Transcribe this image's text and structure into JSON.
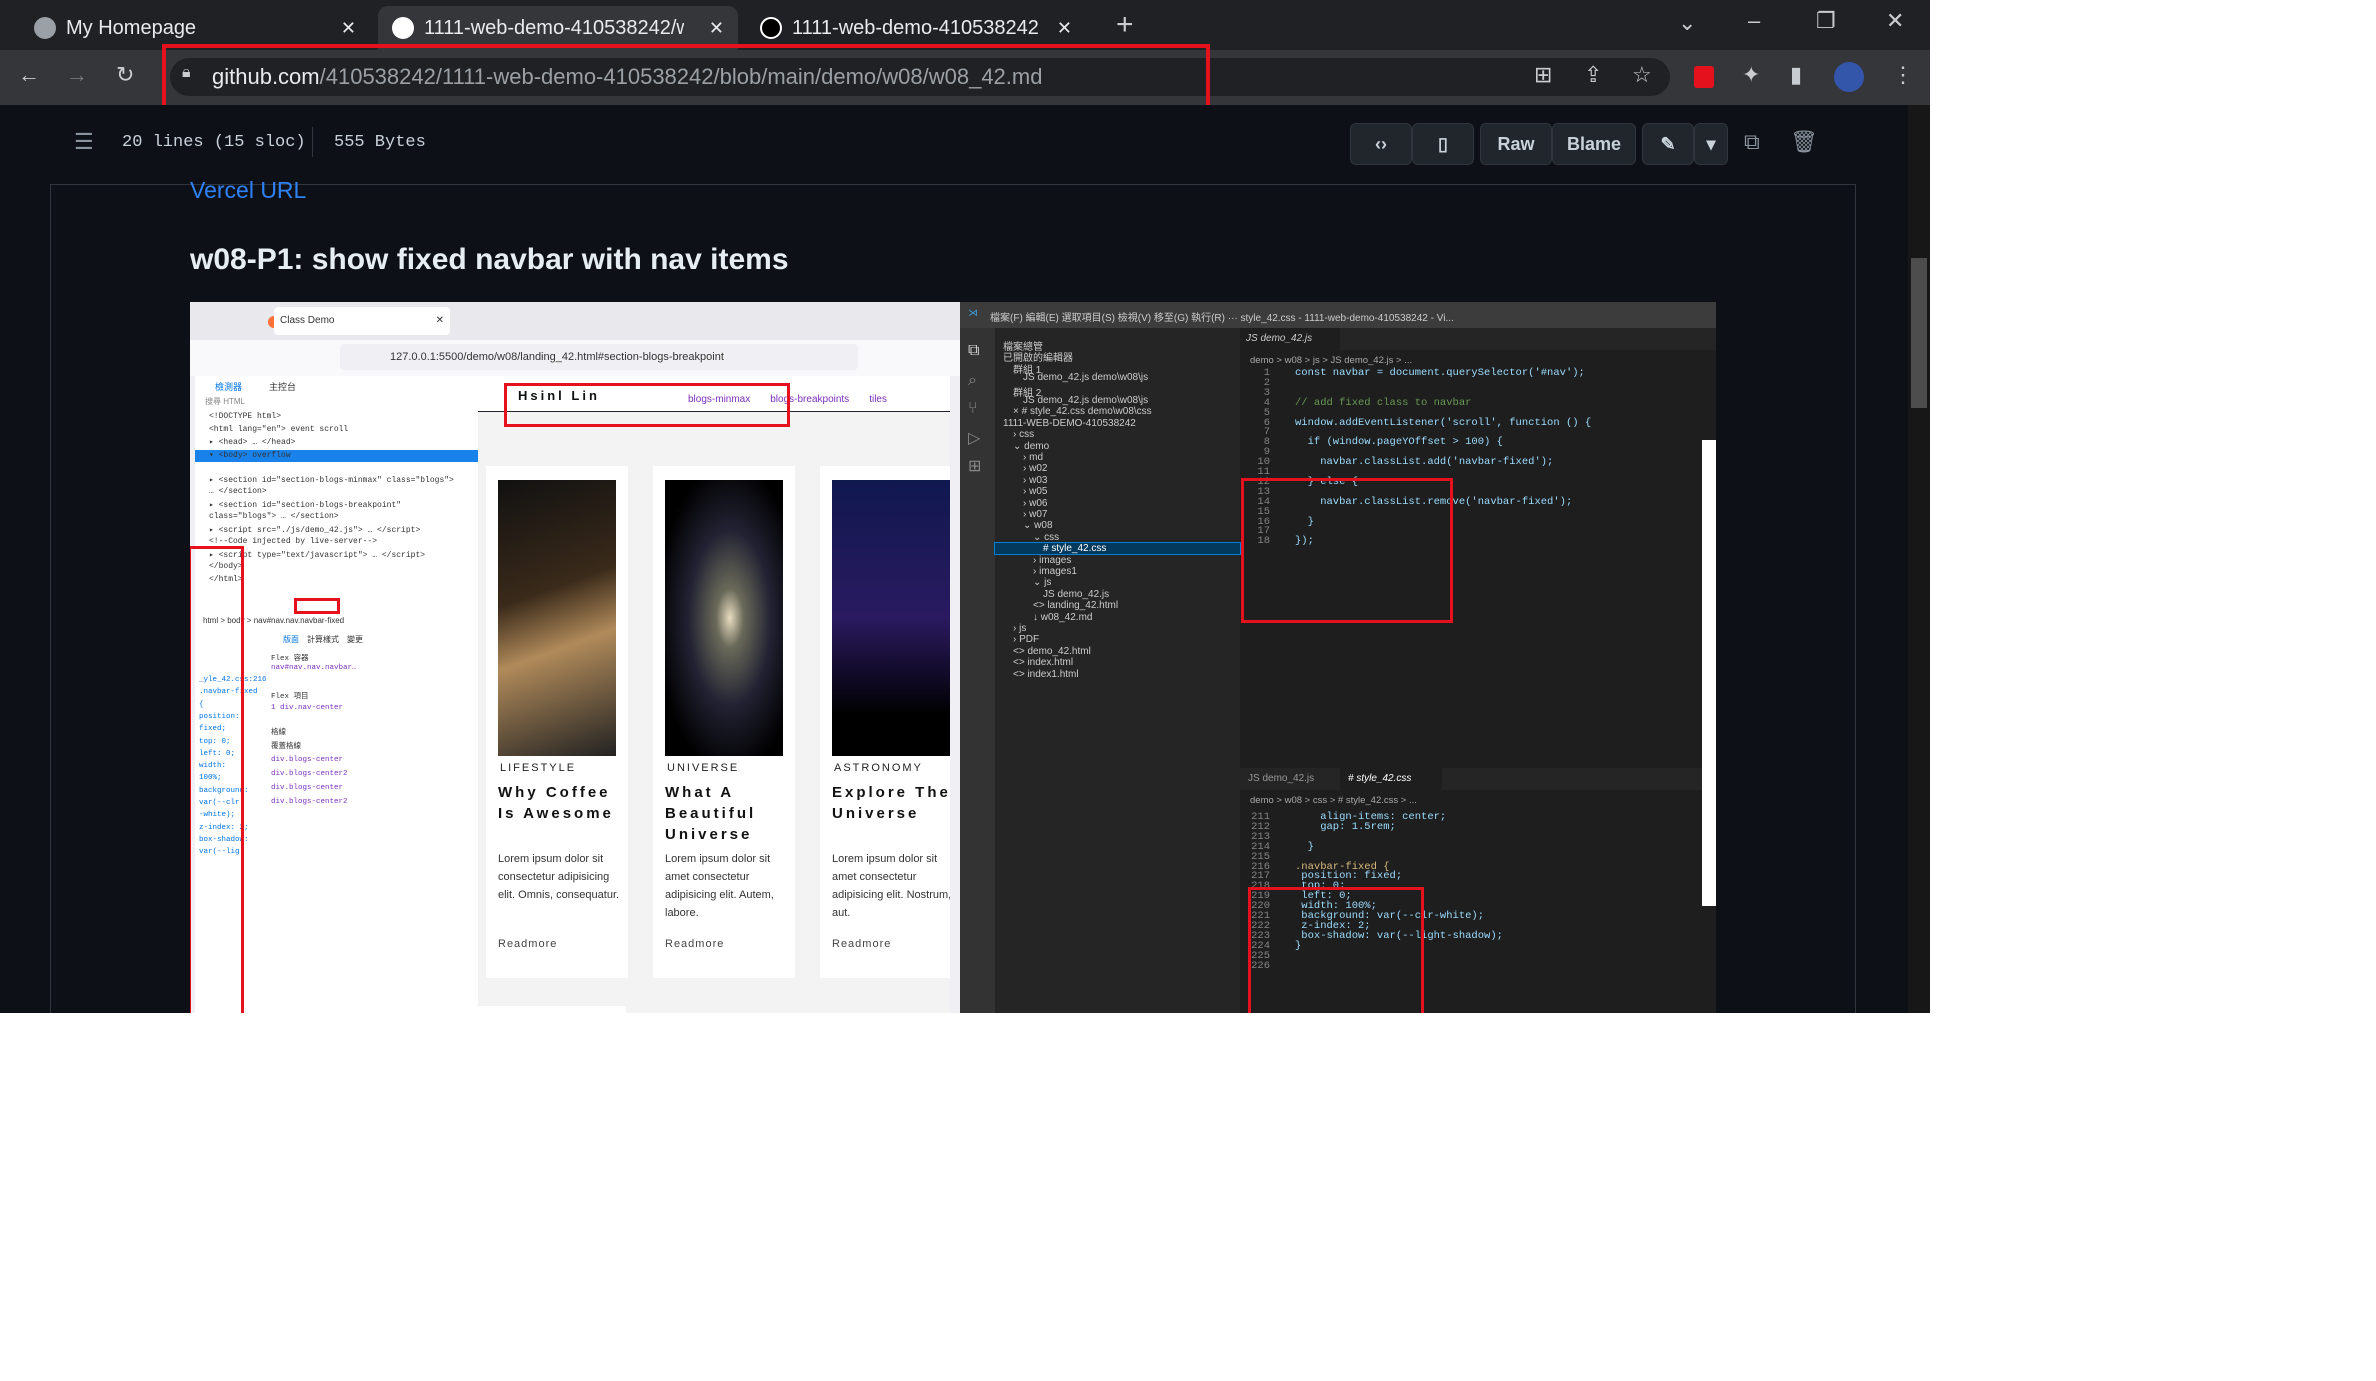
{
  "browser": {
    "tabs": [
      {
        "label": "My Homepage"
      },
      {
        "label": "1111-web-demo-410538242/w"
      },
      {
        "label": "1111-web-demo-410538242"
      }
    ],
    "url_host": "github.com",
    "url_path": "/410538242/1111-web-demo-410538242/blob/main/demo/w08/w08_42.md"
  },
  "file": {
    "lines": "20 lines (15 sloc)",
    "size": "555 Bytes",
    "raw": "Raw",
    "blame": "Blame"
  },
  "content": {
    "link": "Vercel URL",
    "heading": "w08-P1: show fixed navbar with nav items"
  },
  "firefox": {
    "tab": "Class Demo",
    "url": "127.0.0.1:5500/demo/w08/landing_42.html#section-blogs-breakpoint",
    "dev_tabs": [
      "檢測器",
      "主控台"
    ],
    "search": "搜尋 HTML",
    "html_lines": [
      "<!DOCTYPE html>",
      "<html lang=\"en\"> event scroll",
      "▸ <head> … </head>",
      "▾ <body> overflow",
      "▸ <nav id=\"nav\" class=\"nav navbar-fixed\"> … </nav>",
      "▸ <section id=\"section-blogs-minmax\" class=\"blogs\">",
      "  … </section>",
      "▸ <section id=\"section-blogs-breakpoint\"",
      "  class=\"blogs\"> … </section>",
      "▸ <script src=\"./js/demo_42.js\"> … </script>",
      "  <!--Code injected by live-server-->",
      "▸ <script type=\"text/javascript\"> … </script>",
      "  </body>",
      "</html>"
    ],
    "breadcrumb": "html > body > nav#nav.nav.navbar-fixed",
    "rules": [
      "_yle_42.css:216",
      ".navbar-fixed",
      "{",
      "position:",
      "fixed;",
      "top: 0;",
      "left: 0;",
      "width:",
      "100%;",
      "background:",
      "var(--clr",
      "-white);",
      "z-index: 2;",
      "box-shadow:",
      "var(--lig"
    ],
    "layout": [
      "版面",
      "計算樣式",
      "變更"
    ],
    "flex": [
      "Flex 容器",
      "nav#nav.nav.navbar…",
      "Flex 項目",
      "1  div.nav-center",
      "格線",
      "覆蓋格線",
      "div.blogs-center",
      "div.blogs-center2",
      "div.blogs-center",
      "div.blogs-center2"
    ],
    "nav": {
      "brand": "Hsinl Lin",
      "links": [
        "blogs-minmax",
        "blogs-breakpoints",
        "tiles"
      ]
    },
    "cards": [
      {
        "cat": "LIFESTYLE",
        "title": "Why Coffee Is Awesome",
        "text": "Lorem ipsum dolor sit consectetur adipisicing elit. Omnis, consequatur.",
        "more": "Readmore"
      },
      {
        "cat": "UNIVERSE",
        "title": "What A Beautiful Universe",
        "text": "Lorem ipsum dolor sit amet consectetur adipisicing elit. Autem, labore.",
        "more": "Readmore"
      },
      {
        "cat": "ASTRONOMY",
        "title": "Explore The Universe",
        "text": "Lorem ipsum dolor sit amet consectetur adipisicing elit. Nostrum, aut.",
        "more": "Readmore"
      }
    ]
  },
  "vscode": {
    "menu": "檔案(F)  編輯(E)  選取項目(S)  檢視(V)  移至(G)  執行(R)  ···  style_42.css - 1111-web-demo-410538242 - Vi...",
    "explorer": [
      {
        "t": "檔案總管",
        "d": 0
      },
      {
        "t": "已開啟的編輯器",
        "d": 0
      },
      {
        "t": "群組 1",
        "d": 1
      },
      {
        "t": "JS demo_42.js  demo\\w08\\js",
        "d": 2
      },
      {
        "t": "群組 2",
        "d": 1
      },
      {
        "t": "JS demo_42.js  demo\\w08\\js",
        "d": 2
      },
      {
        "t": "× # style_42.css  demo\\w08\\css",
        "d": 1
      },
      {
        "t": "1111-WEB-DEMO-410538242",
        "d": 0
      },
      {
        "t": "› css",
        "d": 1
      },
      {
        "t": "⌄ demo",
        "d": 1
      },
      {
        "t": "› md",
        "d": 2
      },
      {
        "t": "› w02",
        "d": 2
      },
      {
        "t": "› w03",
        "d": 2
      },
      {
        "t": "› w05",
        "d": 2
      },
      {
        "t": "› w06",
        "d": 2
      },
      {
        "t": "› w07",
        "d": 2
      },
      {
        "t": "⌄ w08",
        "d": 2
      },
      {
        "t": "⌄ css",
        "d": 3
      },
      {
        "t": "# style_42.css",
        "d": 4
      },
      {
        "t": "› images",
        "d": 3
      },
      {
        "t": "› images1",
        "d": 3
      },
      {
        "t": "⌄ js",
        "d": 3
      },
      {
        "t": "JS demo_42.js",
        "d": 4
      },
      {
        "t": "<> landing_42.html",
        "d": 3
      },
      {
        "t": "↓ w08_42.md",
        "d": 3
      },
      {
        "t": "› js",
        "d": 1
      },
      {
        "t": "› PDF",
        "d": 1
      },
      {
        "t": "<> demo_42.html",
        "d": 1
      },
      {
        "t": "<> index.html",
        "d": 1
      },
      {
        "t": "<> index1.html",
        "d": 1
      }
    ],
    "top_tab": "JS demo_42.js",
    "top_crumb": "demo > w08 > js > JS demo_42.js > ...",
    "top_code": [
      "const navbar = document.querySelector('#nav');",
      "",
      "",
      "// add fixed class to navbar",
      "",
      "window.addEventListener('scroll', function () {",
      "",
      "  if (window.pageYOffset > 100) {",
      "",
      "    navbar.classList.add('navbar-fixed');",
      "",
      "  } else {",
      "",
      "    navbar.classList.remove('navbar-fixed');",
      "",
      "  }",
      "",
      "});"
    ],
    "top_start": 1,
    "bottom_tabs": [
      "JS demo_42.js",
      "# style_42.css"
    ],
    "bottom_crumb": "demo > w08 > css > # style_42.css > ...",
    "bottom_code": [
      "    align-items: center;",
      "    gap: 1.5rem;",
      "",
      "  }",
      "",
      ".navbar-fixed {",
      " position: fixed;",
      " top: 0;",
      " left: 0;",
      " width: 100%;",
      " background: var(--clr-white);",
      " z-index: 2;",
      " box-shadow: var(--light-shadow);",
      "}",
      "",
      ""
    ],
    "bottom_start": 211
  },
  "colors": {
    "highlight": "#e5121e",
    "link": "#2f81f7"
  }
}
